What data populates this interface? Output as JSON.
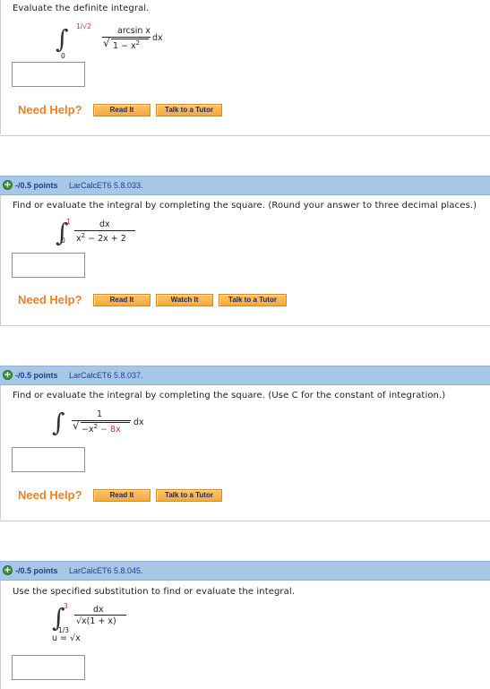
{
  "q0": {
    "prompt": "Evaluate the definite integral.",
    "upper": "1/√2",
    "lower": "0",
    "numerator": "arcsin x",
    "den_prefix": "√",
    "den_text": "1 − x",
    "den_exp": "2",
    "dx": "dx",
    "need_help": "Need Help?",
    "buttons": [
      "Read It",
      "Talk to a Tutor"
    ]
  },
  "q1": {
    "points": "-/0.5 points",
    "ref": "LarCalcET6 5.8.033.",
    "prompt": "Find or evaluate the integral by completing the square. (Round your answer to three decimal places.)",
    "upper": "1",
    "lower": "0",
    "numerator": "dx",
    "den_x": "x",
    "den_exp": "2",
    "den_rest": " − 2x + 2",
    "need_help": "Need Help?",
    "buttons": [
      "Read It",
      "Watch It",
      "Talk to a Tutor"
    ]
  },
  "q2": {
    "points": "-/0.5 points",
    "ref": "LarCalcET6 5.8.037.",
    "prompt": "Find or evaluate the integral by completing the square. (Use C for the constant of integration.)",
    "numerator": "1",
    "den_prefix": "√",
    "den_text": "−x",
    "den_exp": "2",
    "den_rest": " − 8x",
    "dx": "dx",
    "need_help": "Need Help?",
    "buttons": [
      "Read It",
      "Talk to a Tutor"
    ]
  },
  "q3": {
    "points": "-/0.5 points",
    "ref": "LarCalcET6 5.8.045.",
    "prompt": "Use the specified substitution to find or evaluate the integral.",
    "upper": "3",
    "lower": "1/3",
    "numerator": "dx",
    "den_text": "√x(1 + x)",
    "substitution": "u = √x"
  },
  "colors": {
    "header_bg": "#a7c7e7",
    "need_help": "#e8822a",
    "button": "#f5a93c",
    "points_text": "#1f3f8f",
    "plus_icon": "#3a9a3a"
  },
  "icons": {
    "expand": "plus-circle-icon"
  }
}
